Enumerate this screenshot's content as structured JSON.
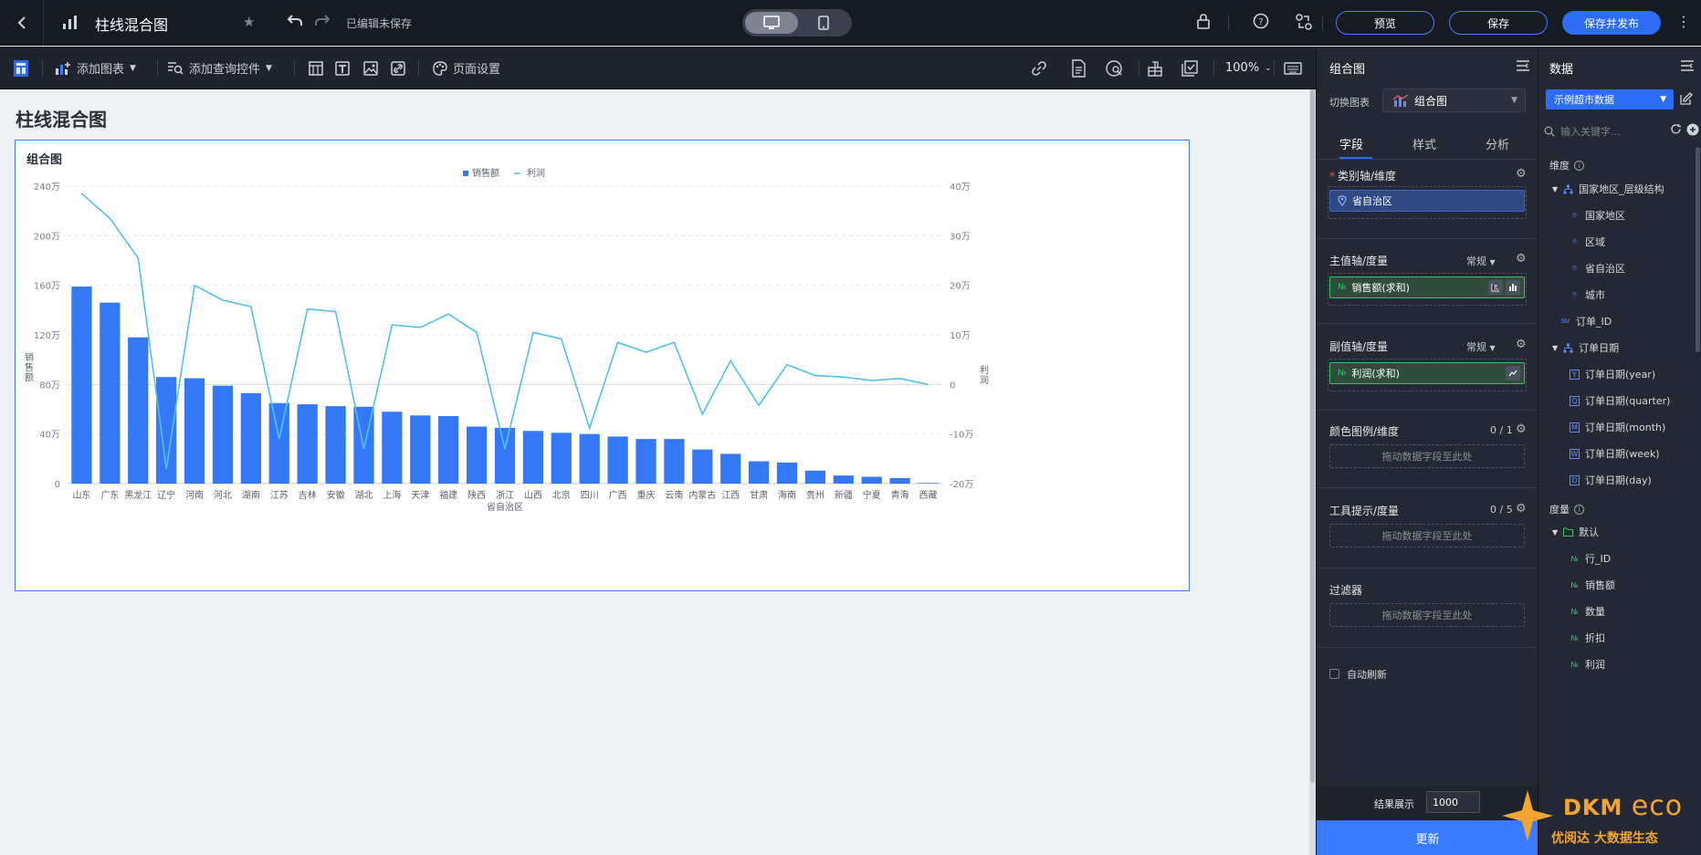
{
  "header": {
    "title": "柱线混合图",
    "save_state": "已编辑未保存",
    "buttons": {
      "preview": "预览",
      "save": "保存",
      "publish": "保存并发布"
    }
  },
  "toolbar": {
    "add_chart": "添加图表",
    "add_query": "添加查询控件",
    "page_settings": "页面设置",
    "zoom": "100%"
  },
  "canvas": {
    "page_title": "柱线混合图",
    "card_title": "组合图"
  },
  "chart_data": {
    "type": "bar",
    "categories": [
      "山东",
      "广东",
      "黑龙江",
      "辽宁",
      "河南",
      "河北",
      "湖南",
      "江苏",
      "吉林",
      "安徽",
      "湖北",
      "上海",
      "天津",
      "福建",
      "陕西",
      "浙江",
      "山西",
      "北京",
      "四川",
      "广西",
      "重庆",
      "云南",
      "内蒙古",
      "江西",
      "甘肃",
      "海南",
      "贵州",
      "新疆",
      "宁夏",
      "青海",
      "西藏"
    ],
    "series": [
      {
        "name": "销售额",
        "type": "bar",
        "axis": "left",
        "color": "#3478f6",
        "values": [
          1590000,
          1460000,
          1180000,
          860000,
          850000,
          790000,
          730000,
          650000,
          640000,
          625000,
          620000,
          580000,
          550000,
          545000,
          460000,
          450000,
          425000,
          410000,
          400000,
          380000,
          360000,
          360000,
          275000,
          240000,
          180000,
          170000,
          105000,
          65000,
          55000,
          45000,
          5000
        ]
      },
      {
        "name": "利润",
        "type": "line",
        "axis": "right",
        "color": "#4ec3e6",
        "values": [
          385000,
          335000,
          255000,
          -170000,
          200000,
          170000,
          157000,
          -110000,
          152000,
          147000,
          -130000,
          120000,
          115000,
          142000,
          105000,
          -130000,
          105000,
          92000,
          -88000,
          85000,
          65000,
          85000,
          -60000,
          48000,
          -42000,
          40000,
          18000,
          15000,
          8000,
          12000,
          0
        ]
      }
    ],
    "xlabel": "省自治区",
    "ylabel_left": "销售额",
    "ylabel_right": "利润",
    "y_left_ticks": [
      "0",
      "40万",
      "80万",
      "120万",
      "160万",
      "200万",
      "240万"
    ],
    "y_right_ticks": [
      "-20万",
      "-10万",
      "0",
      "10万",
      "20万",
      "30万",
      "40万"
    ],
    "ylim_left": [
      0,
      2400000
    ],
    "ylim_right": [
      -200000,
      400000
    ],
    "legend_position": "top-center",
    "grid": true
  },
  "field_panel": {
    "title": "组合图",
    "switch_label": "切换图表",
    "switch_value": "组合图",
    "tabs": [
      "字段",
      "样式",
      "分析"
    ],
    "category_axis": {
      "label": "类别轴/维度",
      "field": "省自治区"
    },
    "main_axis": {
      "label": "主值轴/度量",
      "mode": "常规",
      "field": "销售额(求和)"
    },
    "sub_axis": {
      "label": "副值轴/度量",
      "mode": "常规",
      "field": "利润(求和)"
    },
    "color_legend": {
      "label": "颜色图例/维度",
      "count": "0 / 1",
      "placeholder": "拖动数据字段至此处"
    },
    "tooltip": {
      "label": "工具提示/度量",
      "count": "0 / 5",
      "placeholder": "拖动数据字段至此处"
    },
    "filter": {
      "label": "过滤器",
      "placeholder": "拖动数据字段至此处"
    },
    "auto_refresh": "自动刷新",
    "result_label": "结果展示",
    "result_value": "1000",
    "update": "更新"
  },
  "data_panel": {
    "title": "数据",
    "dataset": "示例超市数据",
    "search_placeholder": "输入关键字...",
    "dimension_label": "维度",
    "dimensions": {
      "geo_group": "国家地区_层级结构",
      "geo_items": [
        "国家地区",
        "区域",
        "省自治区",
        "城市"
      ],
      "order_id": "订单_ID",
      "date_group": "订单日期",
      "date_items": [
        "订单日期(year)",
        "订单日期(quarter)",
        "订单日期(month)",
        "订单日期(week)",
        "订单日期(day)"
      ]
    },
    "measure_label": "度量",
    "measure_group": "默认",
    "measures": [
      "行_ID",
      "销售额",
      "数量",
      "折扣",
      "利润"
    ],
    "logo": {
      "brand": "DKM",
      "eco": "eco",
      "sub": "优阅达 大数据生态"
    }
  }
}
